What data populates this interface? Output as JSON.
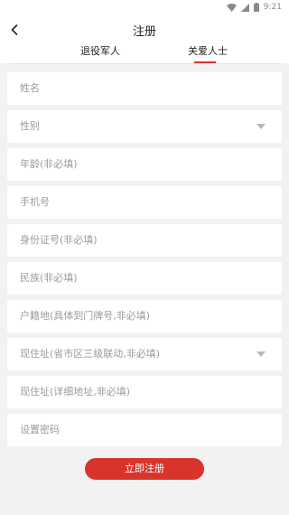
{
  "status_bar": {
    "time": "9:21"
  },
  "header": {
    "title": "注册",
    "tabs": [
      {
        "label": "退役军人",
        "active": false
      },
      {
        "label": "关爱人士",
        "active": true
      }
    ]
  },
  "form": {
    "fields": [
      {
        "placeholder": "姓名",
        "type": "text"
      },
      {
        "placeholder": "性别",
        "type": "select"
      },
      {
        "placeholder": "年龄(非必填)",
        "type": "text"
      },
      {
        "placeholder": "手机号",
        "type": "text"
      },
      {
        "placeholder": "身份证号(非必填)",
        "type": "text"
      },
      {
        "placeholder": "民族(非必填)",
        "type": "text"
      },
      {
        "placeholder": "户籍地(具体到门牌号,非必填)",
        "type": "text"
      },
      {
        "placeholder": "现住址(省市区三级联动,非必填)",
        "type": "select"
      },
      {
        "placeholder": "现住址(详细地址,非必填)",
        "type": "text"
      },
      {
        "placeholder": "设置密码",
        "type": "password"
      }
    ],
    "submit_label": "立即注册"
  },
  "colors": {
    "accent": "#d9342b",
    "background": "#f2f2f2",
    "placeholder": "#9b9b9b"
  },
  "icons": {
    "back": "chevron-left-icon",
    "wifi": "wifi-icon",
    "signal": "cell-signal-icon",
    "battery": "battery-icon",
    "dropdown": "caret-down-icon"
  }
}
